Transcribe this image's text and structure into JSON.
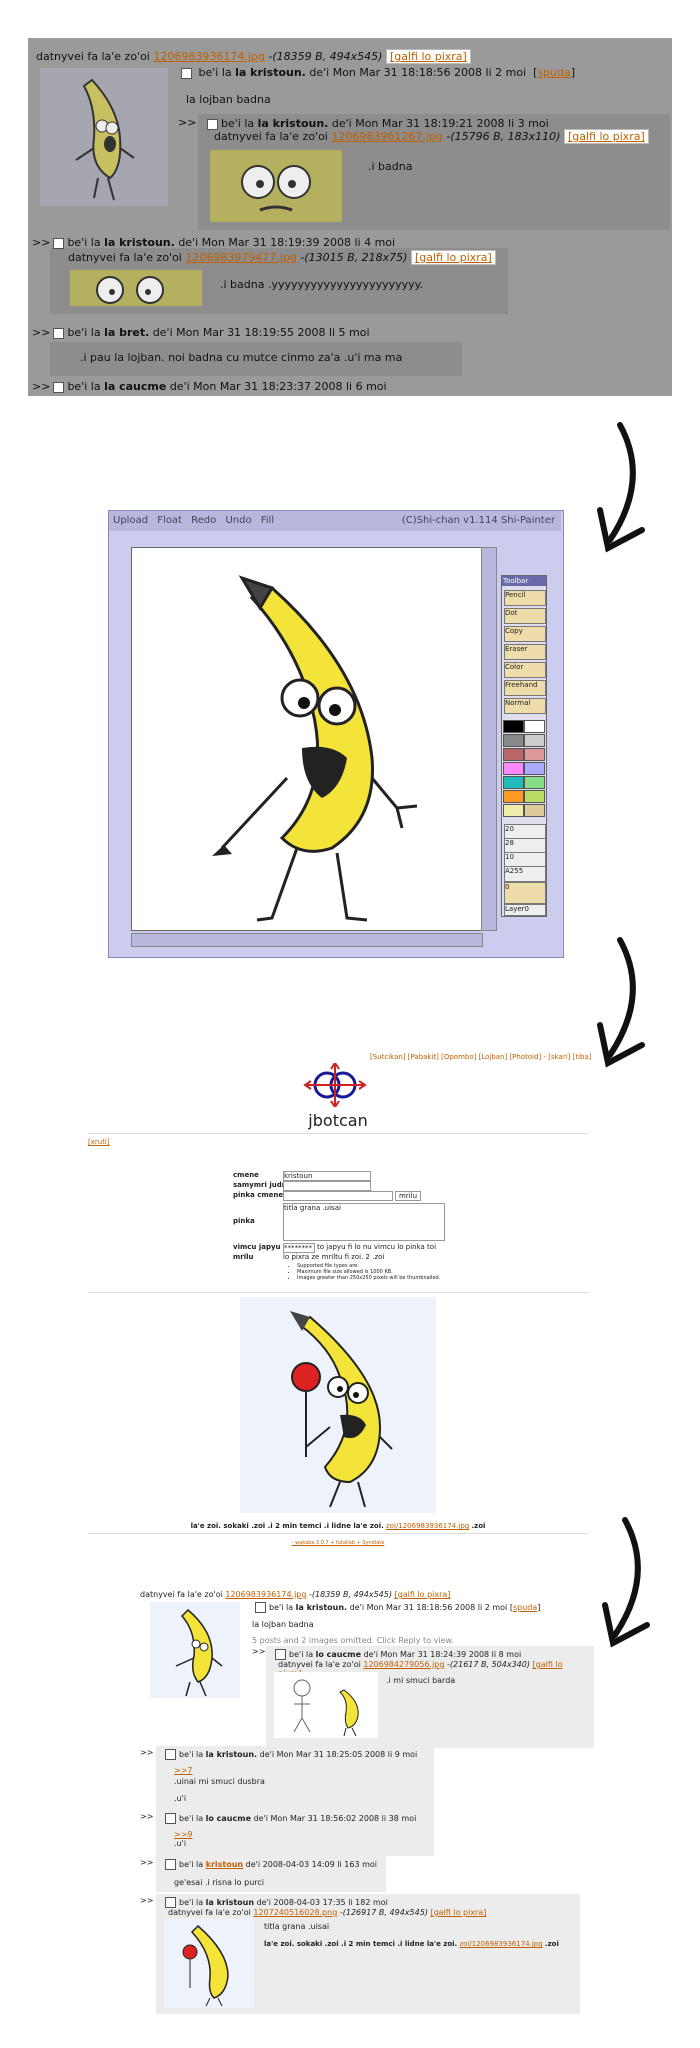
{
  "panel1": {
    "op_prefix": "datnyvei fa la'e zo'oi",
    "op_file": "1206983936174.jpg",
    "op_meta": "-(18359 B, 494x545)",
    "op_google": "[galfi lo pixra]",
    "op_name_prefix": "be'i la",
    "op_name": "la kristoun.",
    "op_date": "de'i Mon Mar 31 18:18:56 2008 li 2 moi",
    "op_reply": "spuda",
    "op_text": "la lojban badna",
    "r1_arrow": ">>",
    "r1_name": "la kristoun.",
    "r1_date": "de'i Mon Mar 31 18:19:21 2008 li 3 moi",
    "r1_file_prefix": "datnyvei fa la'e zo'oi",
    "r1_file": "1206983961267.jpg",
    "r1_meta": "-(15796 B, 183x110)",
    "r1_google": "[galfi lo pixra]",
    "r1_text": ".i badna",
    "r2_name": "la kristoun.",
    "r2_date": "de'i Mon Mar 31 18:19:39 2008 li 4 moi",
    "r2_file_prefix": "datnyvei fa la'e zo'oi",
    "r2_file": "1206983979477.jpg",
    "r2_meta": "-(13015 B, 218x75)",
    "r2_google": "[galfi lo pixra]",
    "r2_text": ".i badna .yyyyyyyyyyyyyyyyyyyyyyy.",
    "r3_name": "la bret.",
    "r3_date": "de'i Mon Mar 31 18:19:55 2008 li 5 moi",
    "r3_text": ".i pau la lojban. noi badna cu mutce cinmo za'a .u'i ma ma",
    "r4_name": "la caucme",
    "r4_date": "de'i Mon Mar 31 18:23:37 2008 li 6 moi"
  },
  "paint": {
    "buttons": [
      "Upload",
      "Float",
      "Redo",
      "Undo",
      "Fill"
    ],
    "credit": "(C)Shi-chan v1.114 Shi-Painter",
    "toolbar_title": "Toolbar",
    "tools": [
      "Pencil",
      "Dot",
      "Copy",
      "Eraser",
      "Color",
      "Freehand",
      "Normal"
    ],
    "sliders": [
      "20",
      "28",
      "10",
      "A255",
      "0"
    ],
    "layer": "Layer0",
    "swatches": [
      "#000000",
      "#ffffff",
      "#888888",
      "#cccccc",
      "#bb6666",
      "#dd9999",
      "#ff88ff",
      "#aaaaff",
      "#4444ff",
      "#22bbbb",
      "#88dd88",
      "#ff9922",
      "#bbdd66",
      "#eeeeaa",
      "#ddcc99"
    ]
  },
  "board": {
    "top_links": "[Sutcikan] [Pabakit] [Opombo] [Lojban] [Photoid] - [skari] [tiba]",
    "title": "jbotcan",
    "back_link": "[xruti]",
    "form": {
      "cmene_label": "cmene",
      "cmene_value": "kristoun",
      "samymri_label": "samymri judri",
      "pinka_cmene_label": "pinka cmene",
      "submit_label": "mrilu",
      "pinka_label": "pinka",
      "pinka_value": "titla grana .uisai",
      "vimcu_label": "vimcu japyu",
      "vimcu_value": "********",
      "vimcu_hint": "to japyu fi lo nu vimcu lo pinka toi",
      "mrilu_label": "mrilu",
      "mrilu_hint": "lo pixra ze mriltu fi zoi. 2 .zoi",
      "rules": [
        "Supported file types are:",
        "Maximum file size allowed is 1000 KB.",
        "Images greater than 250x250 pixels will be thumbnailed."
      ]
    },
    "caption": "la'e zoi. sokaki .zoi .i 2 min temci .i lidne la'e zoi.",
    "caption_link": "zoi/1206983936174.jpg",
    "caption_suffix": ".zoi",
    "footer_links": "- wakaba 3.0.7 + futallab + Syndiate"
  },
  "thread2": {
    "op_prefix": "datnyvei fa la'e zo'oi",
    "op_file": "1206983936174.jpg",
    "op_meta": "-(18359 B, 494x545)",
    "op_google": "[galfi lo pixra]",
    "op_name": "la kristoun.",
    "op_date": "de'i Mon Mar 31 18:18:56 2008 li 2 moi",
    "op_reply": "spuda",
    "op_text": "la lojban badna",
    "omitted": "5 posts and 2 images omitted. Click Reply to view.",
    "r1_name": "lo caucme",
    "r1_date": "de'i Mon Mar 31 18:24:39 2008 li 8 moi",
    "r1_file_prefix": "datnyvei fa la'e zo'oi",
    "r1_file": "1206984279056.jpg",
    "r1_meta": "-(21617 B, 504x340)",
    "r1_google": "[galfi lo pixra]",
    "r1_text": ".i mi smuci barda",
    "r2_name": "la kristoun.",
    "r2_date": "de'i Mon Mar 31 18:25:05 2008 li 9 moi",
    "r2_quote": ">>7",
    "r2_text1": ".uinai mi smuci dusbra",
    "r2_text2": ".u'i",
    "r3_name": "lo caucme",
    "r3_date": "de'i Mon Mar 31 18:56:02 2008 li 38 moi",
    "r3_quote": ">>9",
    "r3_text": ".u'i",
    "r4_name": "kristoun",
    "r4_date": "de'i 2008-04-03 14:09 li 163 moi",
    "r4_text": "ge'esai .i risna lo purci",
    "r5_name": "la kristoun",
    "r5_date": "de'i 2008-04-03 17:35 li 182 moi",
    "r5_file_prefix": "datnyvei fa la'e zo'oi",
    "r5_file": "1207240516028.png",
    "r5_meta": "-(126917 B, 494x545)",
    "r5_google": "[galfi lo pixra]",
    "r5_text1": "titla grana .uisai",
    "r5_text2": "la'e zoi. sokaki .zoi .i 2 min temci .i lidne la'e zoi.",
    "r5_link": "zoi/1206983936174.jpg",
    "r5_suffix": ".zoi"
  }
}
